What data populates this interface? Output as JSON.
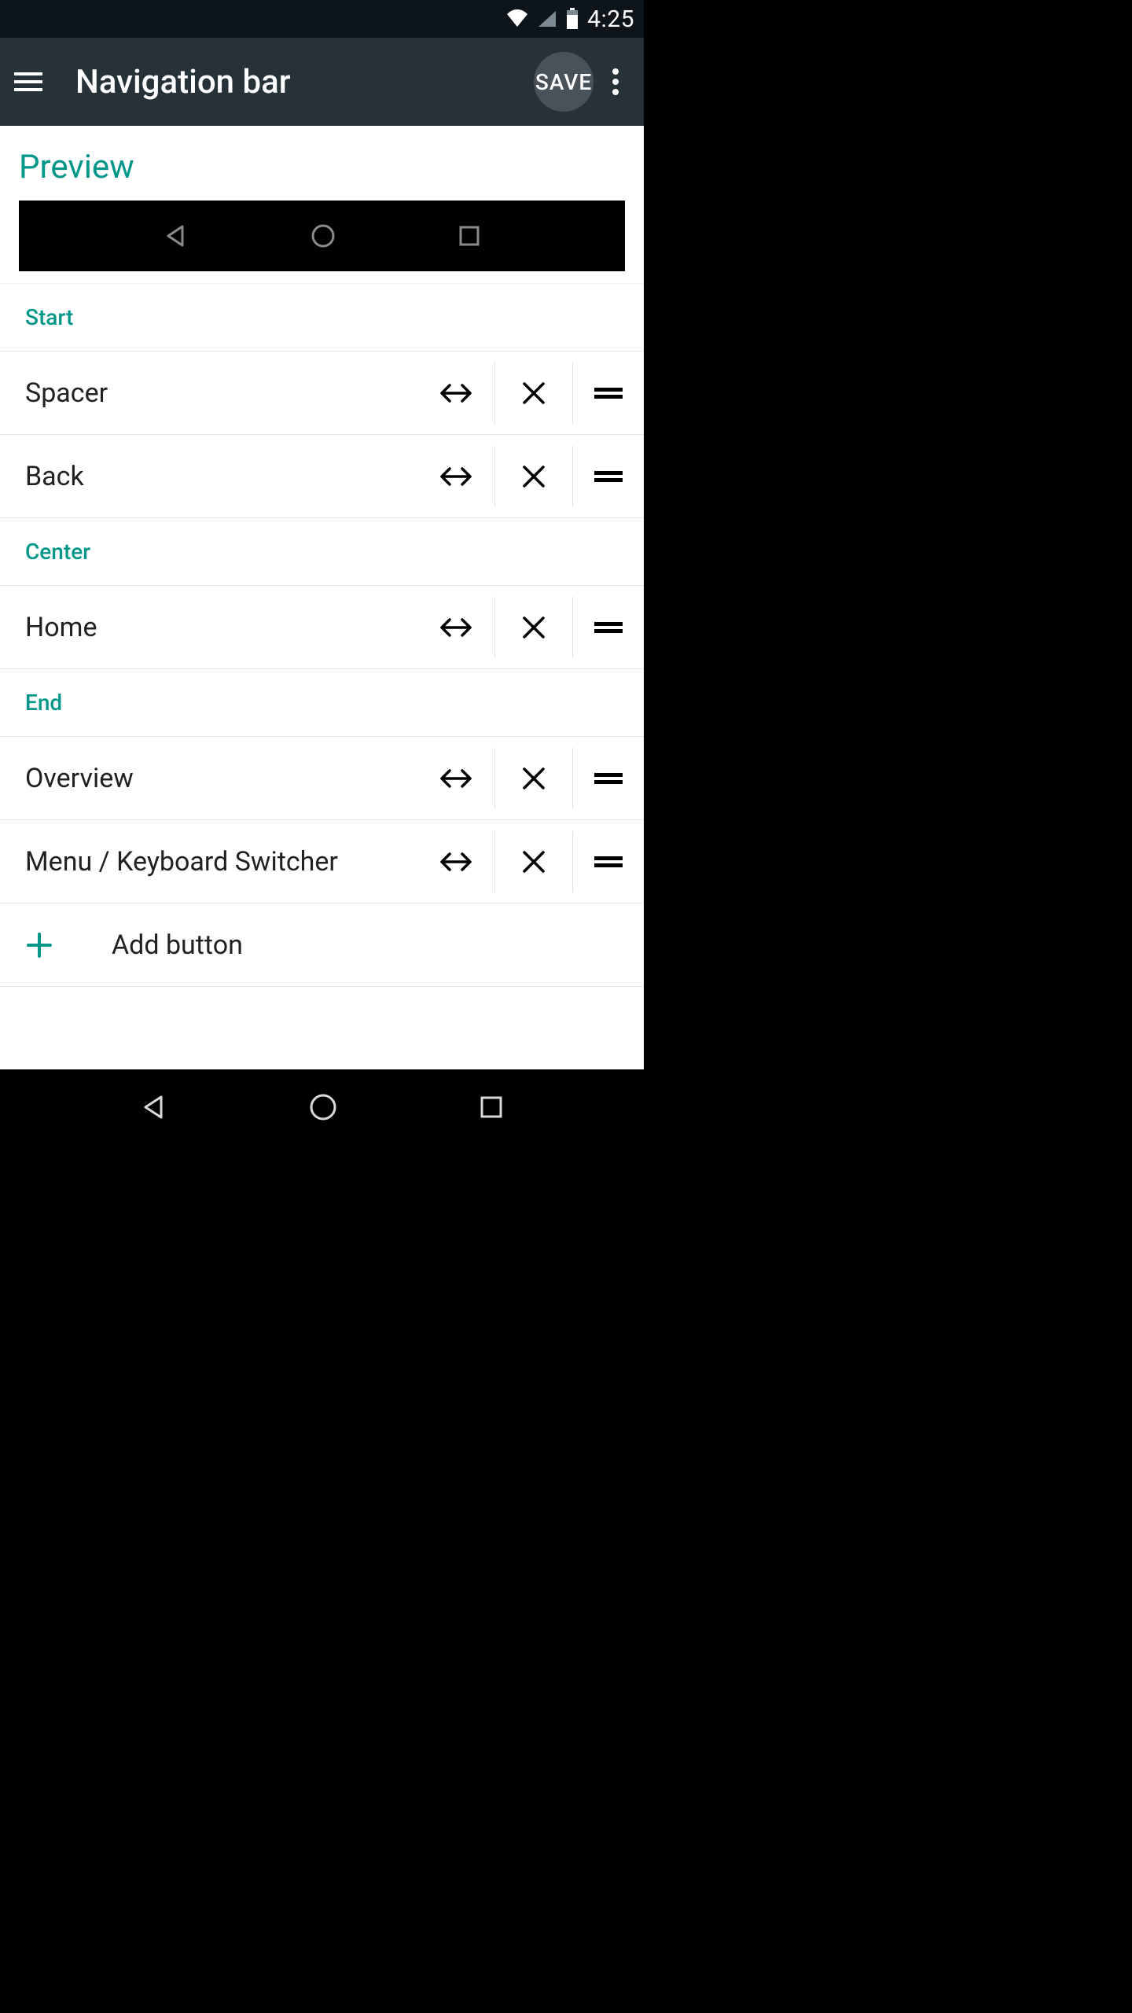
{
  "status": {
    "time": "4:25"
  },
  "appbar": {
    "title": "Navigation bar",
    "save": "SAVE"
  },
  "preview": {
    "title": "Preview"
  },
  "sections": {
    "start": {
      "header": "Start",
      "items": [
        {
          "label": "Spacer"
        },
        {
          "label": "Back"
        }
      ]
    },
    "center": {
      "header": "Center",
      "items": [
        {
          "label": "Home"
        }
      ]
    },
    "end": {
      "header": "End",
      "items": [
        {
          "label": "Overview"
        },
        {
          "label": "Menu / Keyboard Switcher"
        }
      ]
    }
  },
  "add_button": {
    "label": "Add button"
  },
  "colors": {
    "accent": "#009688",
    "appbar_bg": "#263238",
    "status_bg": "#0e151a"
  },
  "icons": {
    "menu": "hamburger-icon",
    "overflow": "overflow-icon",
    "nav_back": "triangle-back-icon",
    "nav_home": "circle-home-icon",
    "nav_recents": "square-recents-icon",
    "width": "horizontal-arrows-icon",
    "remove": "close-x-icon",
    "drag": "drag-handle-icon",
    "plus": "plus-icon",
    "wifi": "wifi-icon",
    "cell": "cell-signal-icon",
    "battery": "battery-icon"
  }
}
